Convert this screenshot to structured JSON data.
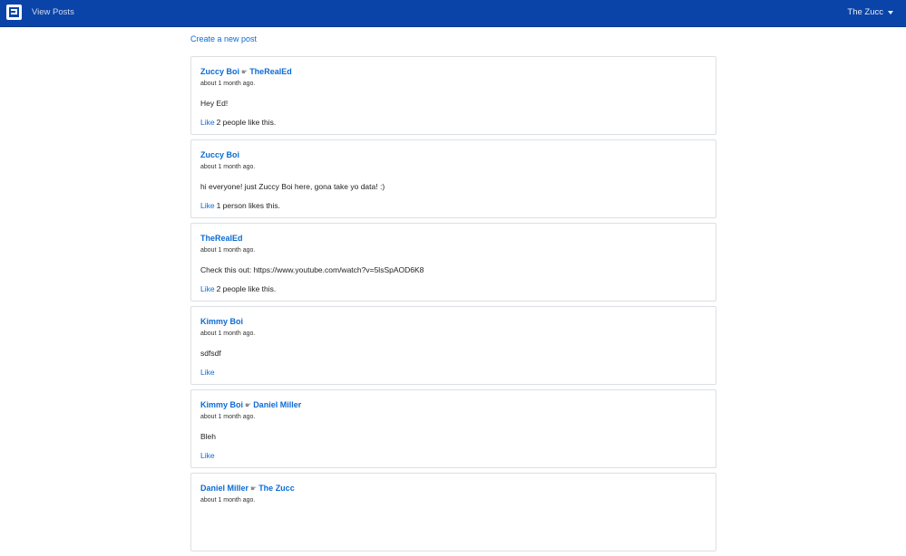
{
  "nav": {
    "view_posts": "View Posts",
    "user_name": "The Zucc"
  },
  "create_post": "Create a new post",
  "like_label": "Like",
  "arrow_glyph": "☛",
  "posts": [
    {
      "author": "Zuccy Boi",
      "recipient": "TheRealEd",
      "time": "about 1 month ago.",
      "body": "Hey Ed!",
      "likes": "2 people like this."
    },
    {
      "author": "Zuccy Boi",
      "recipient": "",
      "time": "about 1 month ago.",
      "body": "hi everyone! just Zuccy Boi here, gona take yo data! :)",
      "likes": "1 person likes this."
    },
    {
      "author": "TheRealEd",
      "recipient": "",
      "time": "about 1 month ago.",
      "body": "Check this out: https://www.youtube.com/watch?v=5lsSpAOD6K8",
      "likes": "2 people like this."
    },
    {
      "author": "Kimmy Boi",
      "recipient": "",
      "time": "about 1 month ago.",
      "body": "sdfsdf",
      "likes": ""
    },
    {
      "author": "Kimmy Boi",
      "recipient": "Daniel Miller",
      "time": "about 1 month ago.",
      "body": "Bleh",
      "likes": ""
    },
    {
      "author": "Daniel Miller",
      "recipient": "The Zucc",
      "time": "about 1 month ago.",
      "body": "",
      "likes": ""
    }
  ],
  "colors": {
    "navbar": "#0b44a8",
    "link": "#0b6bd4"
  }
}
